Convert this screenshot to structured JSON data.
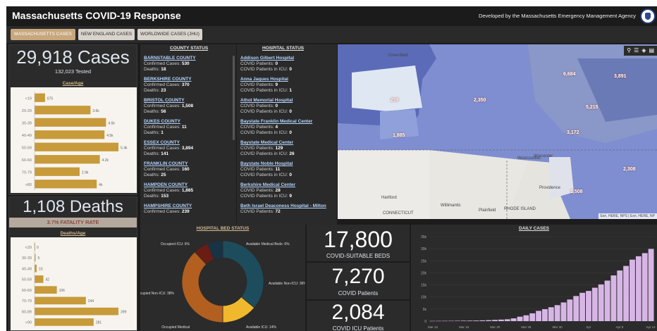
{
  "header": {
    "title": "Massachusetts COVID-19 Response",
    "credit": "Developed by the Massachusetts Emergency Management Agency"
  },
  "tabs": [
    {
      "label": "MASSACHUSETTS CASES",
      "active": true
    },
    {
      "label": "NEW ENGLAND CASES",
      "active": false
    },
    {
      "label": "WORLDWIDE CASES (JHU)",
      "active": false
    }
  ],
  "cases_panel": {
    "total": "29,918 Cases",
    "tested": "132,023 Tested",
    "chart_title": "Case/Age"
  },
  "deaths_panel": {
    "total": "1,108 Deaths",
    "fatality_rate": "3.7% FATALITY RATE",
    "chart_title": "Deaths/Age"
  },
  "county_status": {
    "title": "COUNTY STATUS",
    "items": [
      {
        "name": "BARNSTABLE COUNTY",
        "confirmed_label": "Confirmed Cases: ",
        "confirmed": "530",
        "deaths_label": "Deaths: ",
        "deaths": "18"
      },
      {
        "name": "BERKSHIRE COUNTY",
        "confirmed_label": "Confirmed Cases: ",
        "confirmed": "370",
        "deaths_label": "Deaths: ",
        "deaths": "23"
      },
      {
        "name": "BRISTOL COUNTY",
        "confirmed_label": "Confirmed Cases: ",
        "confirmed": "1,508",
        "deaths_label": "Deaths: ",
        "deaths": "56"
      },
      {
        "name": "DUKES COUNTY",
        "confirmed_label": "Confirmed Cases: ",
        "confirmed": "11",
        "deaths_label": "Deaths: ",
        "deaths": "1"
      },
      {
        "name": "ESSEX COUNTY",
        "confirmed_label": "Confirmed Cases: ",
        "confirmed": "3,894",
        "deaths_label": "Deaths: ",
        "deaths": "141"
      },
      {
        "name": "FRANKLIN COUNTY",
        "confirmed_label": "Confirmed Cases: ",
        "confirmed": "160",
        "deaths_label": "Deaths: ",
        "deaths": "25"
      },
      {
        "name": "HAMPDEN COUNTY",
        "confirmed_label": "Confirmed Cases: ",
        "confirmed": "1,885",
        "deaths_label": "Deaths: ",
        "deaths": "153"
      },
      {
        "name": "HAMPSHIRE COUNTY",
        "confirmed_label": "Confirmed Cases: ",
        "confirmed": "239",
        "deaths_label": "",
        "deaths": ""
      }
    ]
  },
  "hospital_status": {
    "title": "HOSPITAL STATUS",
    "items": [
      {
        "name": "Addison Gilbert Hospital",
        "patients_label": "COVID Patients: ",
        "patients": "0",
        "icu_label": "COVID Patients in ICU: ",
        "icu": "0"
      },
      {
        "name": "Anna Jaques Hospital",
        "patients_label": "COVID Patients: ",
        "patients": "9",
        "icu_label": "COVID Patients in ICU: ",
        "icu": "1"
      },
      {
        "name": "Athol Memorial Hospital",
        "patients_label": "COVID Patients: ",
        "patients": "0",
        "icu_label": "COVID Patients in ICU: ",
        "icu": "0"
      },
      {
        "name": "Baystate Franklin Medical Center",
        "patients_label": "COVID Patients: ",
        "patients": "4",
        "icu_label": "COVID Patients in ICU: ",
        "icu": "0"
      },
      {
        "name": "Baystate Medical Center",
        "patients_label": "COVID Patients: ",
        "patients": "129",
        "icu_label": "COVID Patients in ICU: ",
        "icu": "26"
      },
      {
        "name": "Baystate Noble Hospital",
        "patients_label": "COVID Patients: ",
        "patients": "11",
        "icu_label": "COVID Patients in ICU: ",
        "icu": "0"
      },
      {
        "name": "Berkshire Medical Center",
        "patients_label": "COVID Patients: ",
        "patients": "28",
        "icu_label": "COVID Patients in ICU: ",
        "icu": "9"
      },
      {
        "name": "Beth Israel Deaconess Hospital - Milton",
        "patients_label": "COVID Patients: ",
        "patients": "72",
        "icu_label": "",
        "icu": ""
      }
    ]
  },
  "map": {
    "tools": [
      "⚲",
      "☰",
      "◈",
      "▤"
    ],
    "attribution": "Esri, HERE, NPS | Esri, HERE, NP",
    "places": [
      "Greenfield",
      "Worcester",
      "Woonsocket",
      "Providence",
      "Hartford",
      "Willimantic",
      "Plainfield",
      "RHODE ISLAND",
      "CONNECTICUT"
    ],
    "region_labels": [
      "6,684",
      "3,891",
      "2,350",
      "5,215",
      "3,172",
      "1,885",
      "2,308",
      "1,508",
      "239"
    ]
  },
  "hospital_beds": {
    "title": "HOSPITAL BED STATUS",
    "segments_text": [
      "Occupied ICU: 6%",
      "Available Medical Beds: 6%",
      "Available Non-ICU: 36%",
      "Available ICU: 14%",
      "Occupied Medical",
      "Occupied Non-ICU: 38%"
    ]
  },
  "stats": [
    {
      "value": "17,800",
      "label": "COVID-SUITABLE BEDS"
    },
    {
      "value": "7,270",
      "label": "COVID Patients"
    },
    {
      "value": "2,084",
      "label": "COVID ICU Patients"
    }
  ],
  "daily_cases": {
    "title": "DAILY CASES"
  },
  "chart_data": [
    {
      "type": "bar",
      "title": "Case/Age",
      "categories": [
        "<19",
        "20-29",
        "30-39",
        "40-49",
        "50-59",
        "60-69",
        "70-79",
        ">80"
      ],
      "values": [
        675,
        3600,
        4600,
        4500,
        5400,
        4200,
        2900,
        4000
      ],
      "value_labels": [
        "675",
        "3.6k",
        "4.6k",
        "4.5k",
        "5.4k",
        "4.2k",
        "2.9k",
        "4k"
      ],
      "orientation": "horizontal",
      "color": "#c79a3a"
    },
    {
      "type": "bar",
      "title": "Deaths/Age",
      "categories": [
        "<29",
        "30-39",
        "40-49",
        "50-59",
        "60-69",
        "70-79",
        "80-89",
        ">90"
      ],
      "values": [
        0,
        5,
        10,
        42,
        106,
        244,
        399,
        281
      ],
      "value_labels": [
        "0",
        "5",
        "10",
        "42",
        "106",
        "244",
        "399",
        "281"
      ],
      "orientation": "horizontal",
      "color": "#c79a3a"
    },
    {
      "type": "pie",
      "title": "HOSPITAL BED STATUS",
      "categories": [
        "Available Non-ICU",
        "Available ICU",
        "Occupied Medical",
        "Occupied Non-ICU",
        "Occupied ICU",
        "Available Medical Beds"
      ],
      "values": [
        36,
        14,
        0,
        38,
        6,
        6
      ],
      "colors": [
        "#1d4d5c",
        "#f0b82c",
        "#b13a18",
        "#b25f1f",
        "#6b1c15",
        "#173447"
      ]
    },
    {
      "type": "bar",
      "title": "DAILY CASES",
      "x_ticks": [
        "Mar 10",
        "Mar 15",
        "Mar 20",
        "Mar 25",
        "Mar 30",
        "Apr",
        "Apr 9",
        "Apr 14"
      ],
      "y_ticks": [
        "0",
        "5k",
        "10k",
        "15k",
        "20k",
        "25k",
        "30k",
        "35k"
      ],
      "ylim": [
        0,
        35000
      ],
      "values": [
        92,
        108,
        123,
        138,
        164,
        197,
        218,
        256,
        328,
        413,
        525,
        646,
        777,
        1159,
        1838,
        2417,
        3240,
        4257,
        4955,
        5752,
        6620,
        7738,
        8966,
        10402,
        11736,
        12500,
        13837,
        15202,
        16790,
        18941,
        20974,
        22860,
        25475,
        26867,
        28163,
        29918
      ],
      "color": "#d7b6e6"
    }
  ]
}
